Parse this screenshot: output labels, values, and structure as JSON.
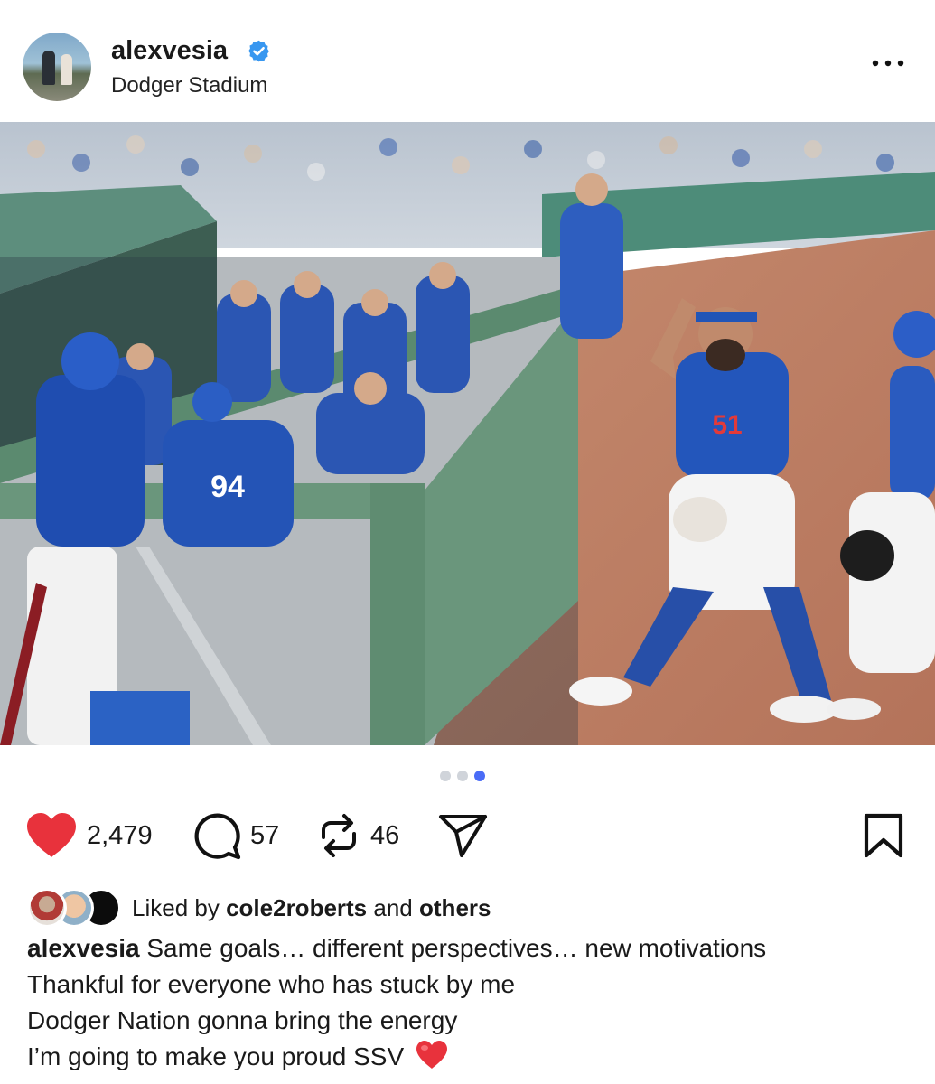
{
  "post": {
    "username": "alexvesia",
    "location": "Dodger Stadium",
    "verified": true
  },
  "photo": {
    "jersey_numbers": [
      "51",
      "94"
    ],
    "carousel_count": 3,
    "carousel_active_index": 2
  },
  "actions": {
    "likes": "2,479",
    "comments": "57",
    "reposts": "46"
  },
  "liked_by": {
    "prefix": "Liked by",
    "user": "cole2roberts",
    "middle": "and",
    "suffix": "others"
  },
  "caption": {
    "username": "alexvesia",
    "lines": [
      "Same goals… different perspectives… new motivations",
      "Thankful for everyone who has stuck by me",
      "Dodger Nation gonna bring the energy",
      "I’m going to make you proud SSV"
    ]
  },
  "colors": {
    "heart": "#e8323c",
    "verified": "#3897f0",
    "dot_active": "#4a6cf7",
    "dodger_blue": "#1f4fb5"
  },
  "icons": {
    "like": "heart-icon",
    "comment": "comment-icon",
    "repost": "repost-icon",
    "share": "send-icon",
    "save": "bookmark-icon",
    "more": "more-icon"
  }
}
